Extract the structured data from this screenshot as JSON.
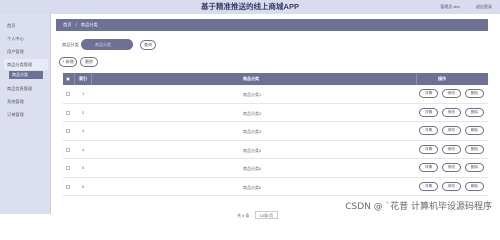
{
  "header": {
    "title": "基于精准推送的线上商城APP",
    "user": "管理员 abo",
    "exit": "退出登录"
  },
  "sidebar": {
    "items": [
      {
        "label": "首页"
      },
      {
        "label": "个人中心"
      },
      {
        "label": "用户管理"
      },
      {
        "label": "商品分类管理"
      },
      {
        "label": "商品信息管理"
      },
      {
        "label": "系统管理"
      },
      {
        "label": "订单管理"
      }
    ],
    "submenu": {
      "label": "商品分类"
    }
  },
  "breadcrumb": {
    "home": "首页",
    "sep": "/",
    "current": "商品分类"
  },
  "search": {
    "label": "商品分类",
    "placeholder": "商品分类",
    "button": "查询"
  },
  "actions": {
    "add": "+ 新增",
    "delete": "删除"
  },
  "table": {
    "headers": {
      "index": "索引",
      "name": "商品分类",
      "op": "操作"
    },
    "rows": [
      {
        "idx": "1",
        "name": "商品分类1"
      },
      {
        "idx": "2",
        "name": "商品分类2"
      },
      {
        "idx": "3",
        "name": "商品分类3"
      },
      {
        "idx": "4",
        "name": "商品分类4"
      },
      {
        "idx": "5",
        "name": "商品分类5"
      },
      {
        "idx": "6",
        "name": "商品分类6"
      }
    ],
    "op_labels": {
      "detail": "详情",
      "edit": "修改",
      "delete": "删除"
    }
  },
  "pagination": {
    "prefix": "共 6 条",
    "page_size": "10条/页"
  },
  "watermark": "CSDN @ `花昔 计算机毕设源码程序"
}
